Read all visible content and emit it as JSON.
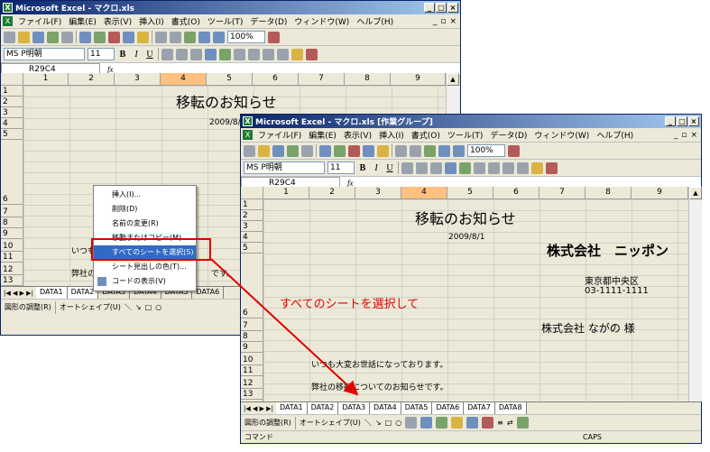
{
  "back_window": {
    "title": "Microsoft Excel - マクロ.xls",
    "menu": [
      "ファイル(F)",
      "編集(E)",
      "表示(V)",
      "挿入(I)",
      "書式(O)",
      "ツール(T)",
      "データ(D)",
      "ウィンドウ(W)",
      "ヘルプ(H)"
    ],
    "font_name": "MS P明朝",
    "font_size": "11",
    "zoom": "100%",
    "name_box": "R29C4",
    "fx": "fx",
    "columns": [
      "1",
      "2",
      "3",
      "4",
      "5",
      "6",
      "7",
      "8",
      "9"
    ],
    "rows": [
      "1",
      "2",
      "3",
      "4",
      "5",
      "6",
      "7",
      "8",
      "9",
      "10",
      "11",
      "12",
      "13"
    ],
    "cell_title": "移転のお知らせ",
    "cell_date": "2009/8/1",
    "cell_r10": "いつも",
    "cell_r12": "弊社の",
    "cell_r12_tail": "です。",
    "tabs": [
      "DATA1",
      "DATA2",
      "DATA3",
      "DATA4",
      "DATA5",
      "DATA6"
    ],
    "drawbar": {
      "draw": "図形の調整(R)",
      "autoshape": "オートシェイプ(U)"
    }
  },
  "context_menu": {
    "items": [
      "挿入(I)...",
      "削除(D)",
      "名前の変更(R)",
      "移動またはコピー(M)...",
      "すべてのシートを選択(S)",
      "シート見出しの色(T)...",
      "コードの表示(V)"
    ]
  },
  "front_window": {
    "title": "Microsoft Excel - マクロ.xls [作業グループ]",
    "menu": [
      "ファイル(F)",
      "編集(E)",
      "表示(V)",
      "挿入(I)",
      "書式(O)",
      "ツール(T)",
      "データ(D)",
      "ウィンドウ(W)",
      "ヘルプ(H)"
    ],
    "font_name": "MS P明朝",
    "font_size": "11",
    "zoom": "100%",
    "name_box": "R29C4",
    "fx": "fx",
    "columns": [
      "1",
      "2",
      "3",
      "4",
      "5",
      "6",
      "7",
      "8",
      "9"
    ],
    "rows": [
      "1",
      "2",
      "3",
      "4",
      "5",
      "6",
      "7",
      "8",
      "9",
      "10",
      "11",
      "12",
      "13"
    ],
    "cell_title": "移転のお知らせ",
    "cell_date": "2009/8/1",
    "cell_company": "株式会社　ニッポン",
    "cell_address": "東京都中央区",
    "cell_phone": "03-1111-1111",
    "cell_recipient": "株式会社 ながの 様",
    "cell_r10": "いつも大変お世話になっております。",
    "cell_r12": "弊社の移転についてのお知らせです。",
    "tabs": [
      "DATA1",
      "DATA2",
      "DATA3",
      "DATA4",
      "DATA5",
      "DATA6",
      "DATA7",
      "DATA8"
    ],
    "drawbar": {
      "draw": "図形の調整(R)",
      "autoshape": "オートシェイプ(U)"
    },
    "status_left": "コマンド",
    "status_caps": "CAPS"
  },
  "annotation": "すべてのシートを選択して",
  "colors": {
    "highlight": "#e00000",
    "title_start": "#0a246a",
    "title_end": "#a6caf0"
  }
}
